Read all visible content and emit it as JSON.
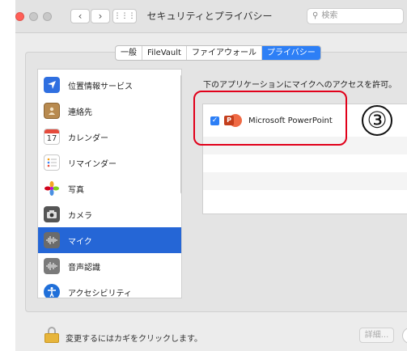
{
  "window": {
    "title": "セキュリティとプライバシー",
    "search_placeholder": "検索",
    "back_glyph": "‹",
    "forward_glyph": "›",
    "grid_glyph": "⋮⋮⋮"
  },
  "tabs": [
    {
      "label": "一般",
      "active": false
    },
    {
      "label": "FileVault",
      "active": false
    },
    {
      "label": "ファイアウォール",
      "active": false
    },
    {
      "label": "プライバシー",
      "active": true
    }
  ],
  "sidebar": {
    "items": [
      {
        "label": "位置情報サービス",
        "icon": "location-icon",
        "selected": false
      },
      {
        "label": "連絡先",
        "icon": "contacts-icon",
        "selected": false
      },
      {
        "label": "カレンダー",
        "icon": "calendar-icon",
        "selected": false,
        "icon_text": "17"
      },
      {
        "label": "リマインダー",
        "icon": "reminders-icon",
        "selected": false
      },
      {
        "label": "写真",
        "icon": "photos-icon",
        "selected": false
      },
      {
        "label": "カメラ",
        "icon": "camera-icon",
        "selected": false
      },
      {
        "label": "マイク",
        "icon": "microphone-icon",
        "selected": true
      },
      {
        "label": "音声認識",
        "icon": "speech-recognition-icon",
        "selected": false
      },
      {
        "label": "アクセシビリティ",
        "icon": "accessibility-icon",
        "selected": false
      }
    ]
  },
  "main": {
    "description": "下のアプリケーションにマイクへのアクセスを許可。",
    "apps": [
      {
        "name": "Microsoft PowerPoint",
        "checked": true,
        "icon": "powerpoint-icon"
      }
    ]
  },
  "annotation": {
    "step_marker": "③",
    "highlight_color": "#e1001a"
  },
  "footer": {
    "lock_text": "変更するにはカギをクリックします。",
    "detail_button": "詳細...",
    "help_button": "?"
  },
  "colors": {
    "accent": "#2d7ff6",
    "selection": "#2566d6"
  }
}
